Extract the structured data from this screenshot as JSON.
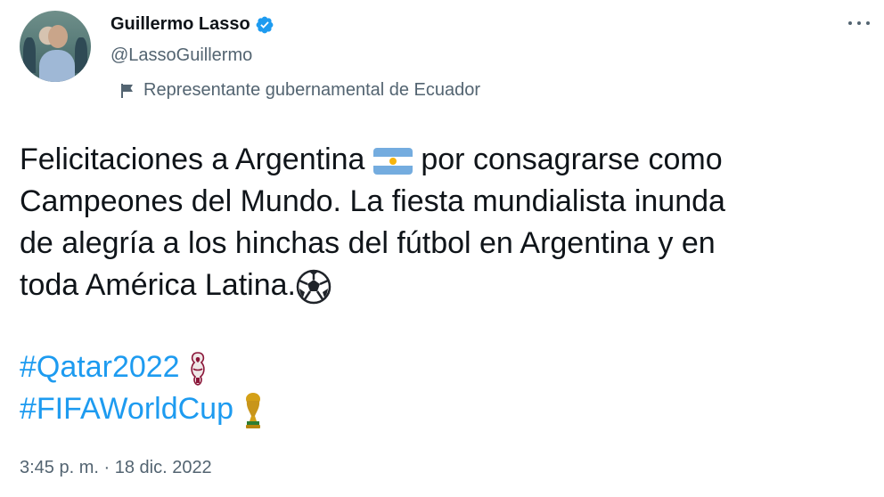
{
  "author": {
    "display_name": "Guillermo Lasso",
    "handle": "@LassoGuillermo",
    "label": "Representante gubernamental de Ecuador",
    "verified_color": "#1d9bf0"
  },
  "tweet": {
    "line1a": "Felicitaciones a Argentina",
    "line1b": "por consagrarse como",
    "line2": "Campeones del Mundo. La fiesta mundialista inunda",
    "line3": "de alegría a los hinchas del fútbol en Argentina y en",
    "line4": "toda América Latina.",
    "emojis": [
      "argentina-flag",
      "soccer-ball",
      "qatar-2022-emblem",
      "world-cup-trophy"
    ]
  },
  "hashtags": {
    "tag1": "#Qatar2022",
    "tag2": "#FIFAWorldCup",
    "color": "#1d9bf0"
  },
  "meta": {
    "timestamp": "3:45 p. m. · 18 dic. 2022"
  }
}
